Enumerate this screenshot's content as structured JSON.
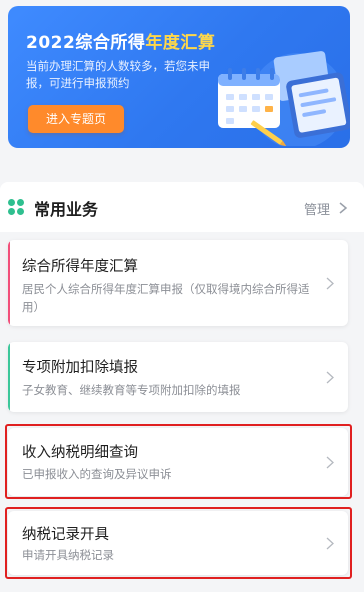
{
  "banner": {
    "title_prefix": "2022综合所得",
    "title_highlight": "年度汇算",
    "subtitle": "当前办理汇算的人数较多，若您未申报，可进行申报预约",
    "button_label": "进入专题页"
  },
  "section": {
    "title": "常用业务",
    "manage_label": "管理"
  },
  "cards": [
    {
      "title": "综合所得年度汇算",
      "desc": "居民个人综合所得年度汇算申报（仅取得境内综合所得适用）",
      "accent": "#f24f7a"
    },
    {
      "title": "专项附加扣除填报",
      "desc": "子女教育、继续教育等专项附加扣除的填报",
      "accent": "#3cc79a"
    },
    {
      "title": "收入纳税明细查询",
      "desc": "已申报收入的查询及异议申诉"
    },
    {
      "title": "纳税记录开具",
      "desc": "申请开具纳税记录"
    }
  ],
  "colors": {
    "banner_blue": "#2f78f0",
    "button_orange": "#ff8a2b",
    "highlight_yellow": "#ffd84a",
    "annotation_red": "#e02020"
  },
  "icons": {
    "section": "clover-icon",
    "banner_art": "calendar-document-illustration",
    "chevron": "chevron-right-icon"
  }
}
